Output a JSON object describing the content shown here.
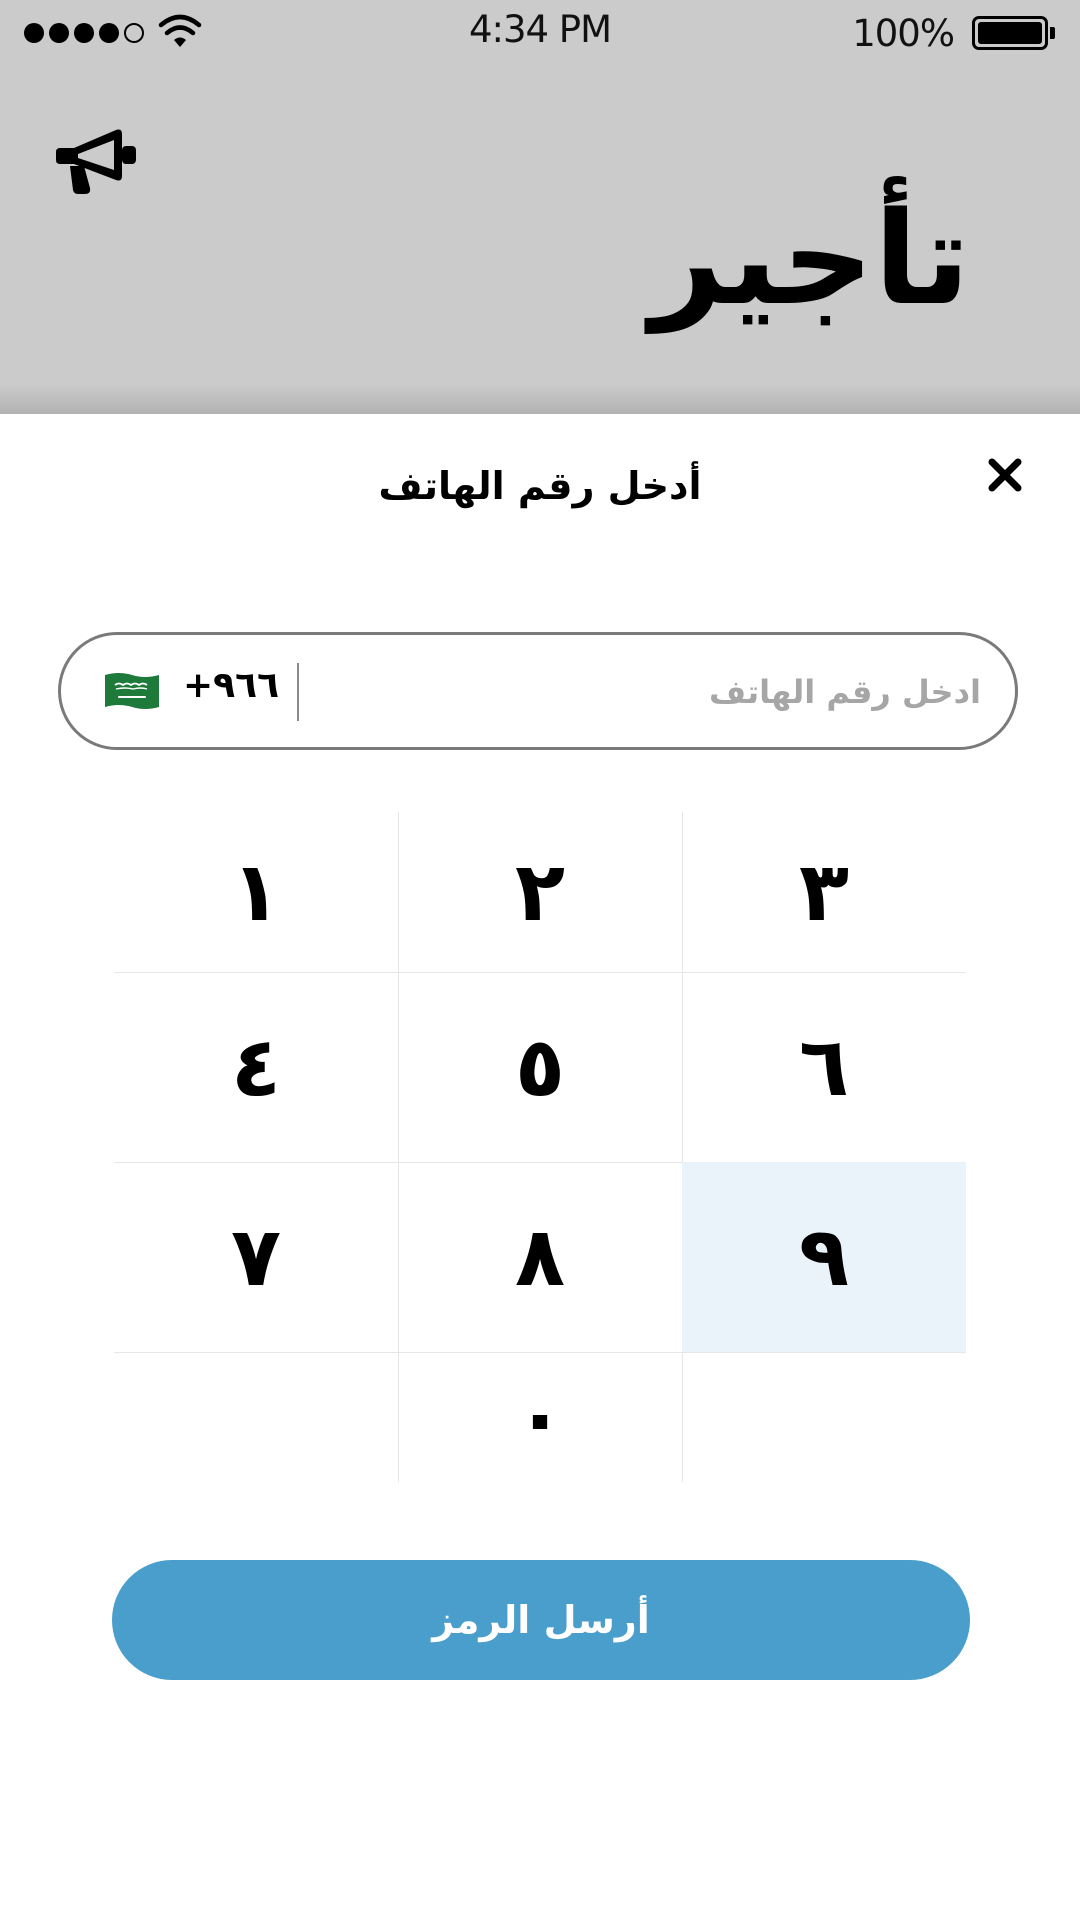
{
  "status_bar": {
    "time": "4:34 PM",
    "battery": "100%",
    "signal_bars_filled": 4,
    "signal_bars_total": 5
  },
  "header": {
    "app_title": "تأجير",
    "announce_icon": "megaphone-icon"
  },
  "sheet": {
    "title": "أدخل رقم الهاتف",
    "close_icon": "close-icon"
  },
  "phone_field": {
    "country_flag": "saudi-flag-icon",
    "country_code": "+٩٦٦",
    "placeholder": "ادخل رقم الهاتف",
    "value": ""
  },
  "keypad": {
    "keys": [
      "١",
      "٢",
      "٣",
      "٤",
      "٥",
      "٦",
      "٧",
      "٨",
      "٩",
      "",
      "٠",
      ""
    ],
    "highlighted": "٩"
  },
  "send_button": {
    "label": "أرسل الرمز",
    "color": "#4a9ecb"
  },
  "colors": {
    "header_background": "#cbcbcb",
    "key_highlight": "#eaf3fa"
  }
}
